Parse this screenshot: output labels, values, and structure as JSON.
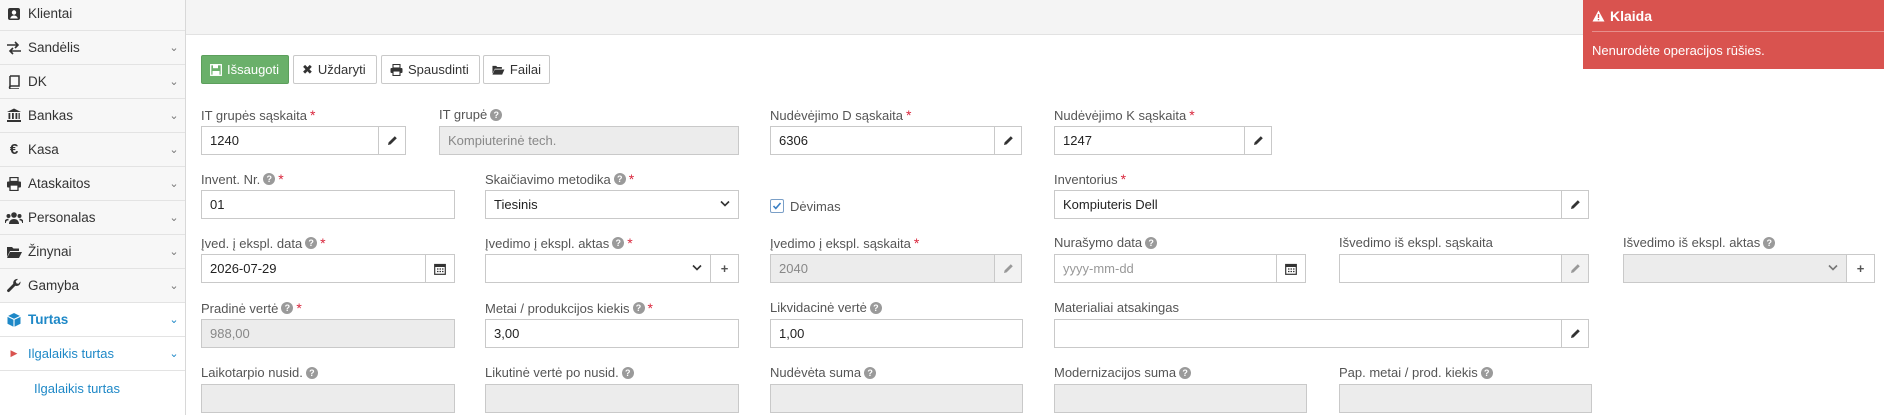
{
  "sidebar": {
    "items": [
      {
        "label": "Klientai",
        "icon": "user-icon"
      },
      {
        "label": "Sandėlis",
        "icon": "exchange-icon"
      },
      {
        "label": "DK",
        "icon": "book-icon"
      },
      {
        "label": "Bankas",
        "icon": "bank-icon"
      },
      {
        "label": "Kasa",
        "icon": "euro-icon"
      },
      {
        "label": "Ataskaitos",
        "icon": "print-icon"
      },
      {
        "label": "Personalas",
        "icon": "users-icon"
      },
      {
        "label": "Žinynai",
        "icon": "folder-open-icon"
      },
      {
        "label": "Gamyba",
        "icon": "wrench-icon"
      },
      {
        "label": "Turtas",
        "icon": "cube-icon"
      }
    ],
    "sub_item": "Ilgalaikis turtas",
    "sub_sub_item": "Ilgalaikis turtas"
  },
  "toolbar": {
    "save": "Išsaugoti",
    "close": "Uždaryti",
    "print": "Spausdinti",
    "files": "Failai"
  },
  "form": {
    "it_group_account": {
      "label": "IT grupės sąskaita",
      "value": "1240"
    },
    "it_group": {
      "label": "IT grupė",
      "value": "Kompiuterinė tech."
    },
    "dep_d_account": {
      "label": "Nudėvėjimo D sąskaita",
      "value": "6306"
    },
    "dep_k_account": {
      "label": "Nudėvėjimo K sąskaita",
      "value": "1247"
    },
    "invent_nr": {
      "label": "Invent. Nr.",
      "value": "01"
    },
    "calc_method": {
      "label": "Skaičiavimo metodika",
      "value": "Tiesinis"
    },
    "depreciation": {
      "label": "Dėvimas",
      "checked": true
    },
    "inventory": {
      "label": "Inventorius",
      "value": "Kompiuteris Dell"
    },
    "commission_date": {
      "label": "Įved. į ekspl. data",
      "value": "2026-07-29"
    },
    "commission_act": {
      "label": "Įvedimo į ekspl. aktas",
      "value": ""
    },
    "commission_account": {
      "label": "Įvedimo į ekspl. sąskaita",
      "value": "2040"
    },
    "writeoff_date": {
      "label": "Nurašymo data",
      "placeholder": "yyyy-mm-dd"
    },
    "removal_account": {
      "label": "Išvedimo iš ekspl. sąskaita",
      "value": ""
    },
    "removal_act": {
      "label": "Išvedimo iš ekspl. aktas",
      "value": ""
    },
    "initial_value": {
      "label": "Pradinė vertė",
      "value": "988,00"
    },
    "years_qty": {
      "label": "Metai / produkcijos kiekis",
      "value": "3,00"
    },
    "liquidation_value": {
      "label": "Likvidacinė vertė",
      "value": "1,00"
    },
    "responsible": {
      "label": "Materialiai atsakingas",
      "value": ""
    },
    "period_dep": {
      "label": "Laikotarpio nusid.",
      "value": ""
    },
    "residual_value": {
      "label": "Likutinė vertė po nusid.",
      "value": ""
    },
    "dep_sum": {
      "label": "Nudėvėta suma",
      "value": ""
    },
    "modernization_sum": {
      "label": "Modernizacijos suma",
      "value": ""
    },
    "extra_years": {
      "label": "Pap. metai / prod. kiekis",
      "value": ""
    }
  },
  "toast": {
    "title": "Klaida",
    "message": "Nenurodėte operacijos rūšies."
  }
}
